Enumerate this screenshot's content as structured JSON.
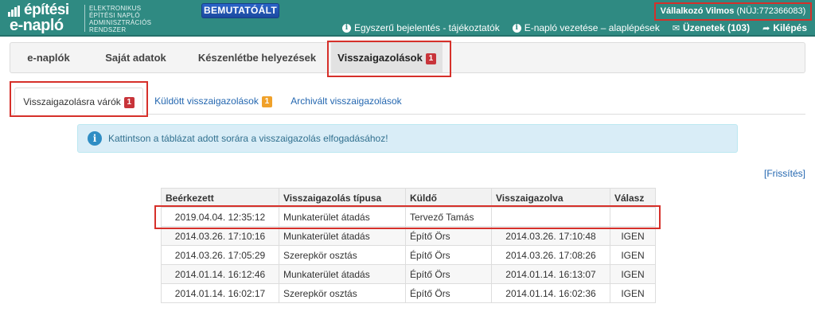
{
  "header": {
    "logo_line1": "építési",
    "logo_line2": "e-napló",
    "logo_sub": [
      "ELEKTRONIKUS",
      "ÉPÍTÉSI NAPLÓ",
      "ADMINISZTRÁCIÓS",
      "RENDSZER"
    ],
    "demo_badge": "BEMUTATÓÁLT",
    "user_name": "Vállalkozó Vilmos",
    "user_code": "(NÜJ:772366083)",
    "links": [
      {
        "icon": "info-icon",
        "label": "Egyszerű bejelentés - tájékoztatók"
      },
      {
        "icon": "info-icon",
        "label": "E-napló vezetése – alaplépések"
      },
      {
        "icon": "envelope-icon",
        "label": "Üzenetek (103)"
      },
      {
        "icon": "logout-arrow-icon",
        "label": "Kilépés"
      }
    ]
  },
  "main_tabs": [
    {
      "label": "e-naplók"
    },
    {
      "label": "Saját adatok"
    },
    {
      "label": "Készenlétbe helyezések"
    },
    {
      "label": "Visszaigazolások",
      "badge": "1",
      "active": true
    }
  ],
  "sub_tabs": [
    {
      "label": "Visszaigazolásra várók",
      "badge": "1",
      "active": true
    },
    {
      "label": "Küldött visszaigazolások",
      "badge": "1"
    },
    {
      "label": "Archivált visszaigazolások"
    }
  ],
  "alert": {
    "icon": "info-icon",
    "text": "Kattintson a táblázat adott sorára a visszaigazolás elfogadásához!"
  },
  "refresh_label": "[Frissítés]",
  "table": {
    "headers": [
      "Beérkezett",
      "Visszaigazolás típusa",
      "Küldő",
      "Visszaigazolva",
      "Válasz"
    ],
    "rows": [
      [
        "2019.04.04. 12:35:12",
        "Munkaterület átadás",
        "Tervező Tamás",
        "",
        ""
      ],
      [
        "2014.03.26. 17:10:16",
        "Munkaterület átadás",
        "Építő Örs",
        "2014.03.26. 17:10:48",
        "IGEN"
      ],
      [
        "2014.03.26. 17:05:29",
        "Szerepkör osztás",
        "Építő Örs",
        "2014.03.26. 17:08:26",
        "IGEN"
      ],
      [
        "2014.01.14. 16:12:46",
        "Munkaterület átadás",
        "Építő Örs",
        "2014.01.14. 16:13:07",
        "IGEN"
      ],
      [
        "2014.01.14. 16:02:17",
        "Szerepkör osztás",
        "Építő Örs",
        "2014.01.14. 16:02:36",
        "IGEN"
      ]
    ]
  },
  "colors": {
    "header_bg": "#2f8a82",
    "highlight": "#d6302a",
    "link": "#2467b0",
    "badge_red": "#c8343a",
    "badge_orange": "#f0a12a"
  }
}
